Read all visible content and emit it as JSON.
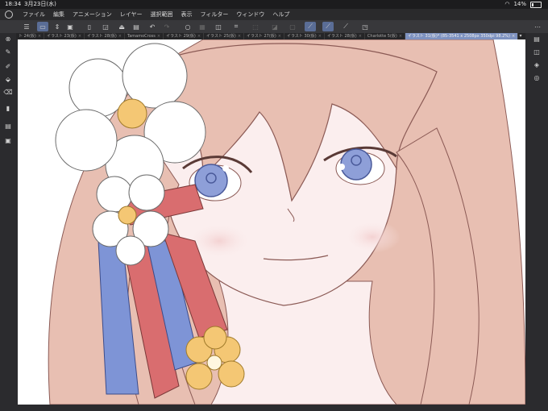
{
  "status_bar": {
    "time": "18:34",
    "date": "3月23日(水)",
    "wifi": "wifi-icon",
    "battery_percent": "14%"
  },
  "menu": {
    "items": [
      "ファイル",
      "編集",
      "アニメーション",
      "レイヤー",
      "選択範囲",
      "表示",
      "フィルター",
      "ウィンドウ",
      "ヘルプ"
    ]
  },
  "toolbar": {
    "icons": [
      "menu-icon",
      "new-canvas-icon",
      "save-icon",
      "open-icon",
      "export-icon",
      "print-icon",
      "undo-icon",
      "redo-icon",
      "clear-icon",
      "fill-icon",
      "transform-icon",
      "deselect-icon",
      "invert-icon",
      "selection-icon",
      "show-selection-icon",
      "snap-ruler-icon",
      "snap-guide-icon",
      "snap-icon",
      "tooltip-icon"
    ]
  },
  "tabs": [
    {
      "label": "ト 24(仮)"
    },
    {
      "label": "イラスト 23(仮)"
    },
    {
      "label": "イラスト 28(仮)"
    },
    {
      "label": "TamamoCross"
    },
    {
      "label": "イラスト 29(仮)"
    },
    {
      "label": "イラスト 25(仮)"
    },
    {
      "label": "イラスト 27(仮)"
    },
    {
      "label": "イラスト 30(仮)"
    },
    {
      "label": "イラスト 28(仮)"
    },
    {
      "label": "Charlotte 5(仮)"
    },
    {
      "label": "イラスト 31(仮)* (85-3541 x 2508px 350dpi 98.2%)"
    }
  ],
  "tab_close": "×",
  "active_tab_index": 10,
  "colors": {
    "accent": "#7e92c0",
    "hair": "#e8bfb2",
    "skin": "#fbeeee",
    "line": "#8b5a55",
    "eye": "#8e9fd8",
    "ribbon_red": "#d96d6f",
    "ribbon_blue": "#7e94d6",
    "flower_yellow": "#f4c774"
  }
}
